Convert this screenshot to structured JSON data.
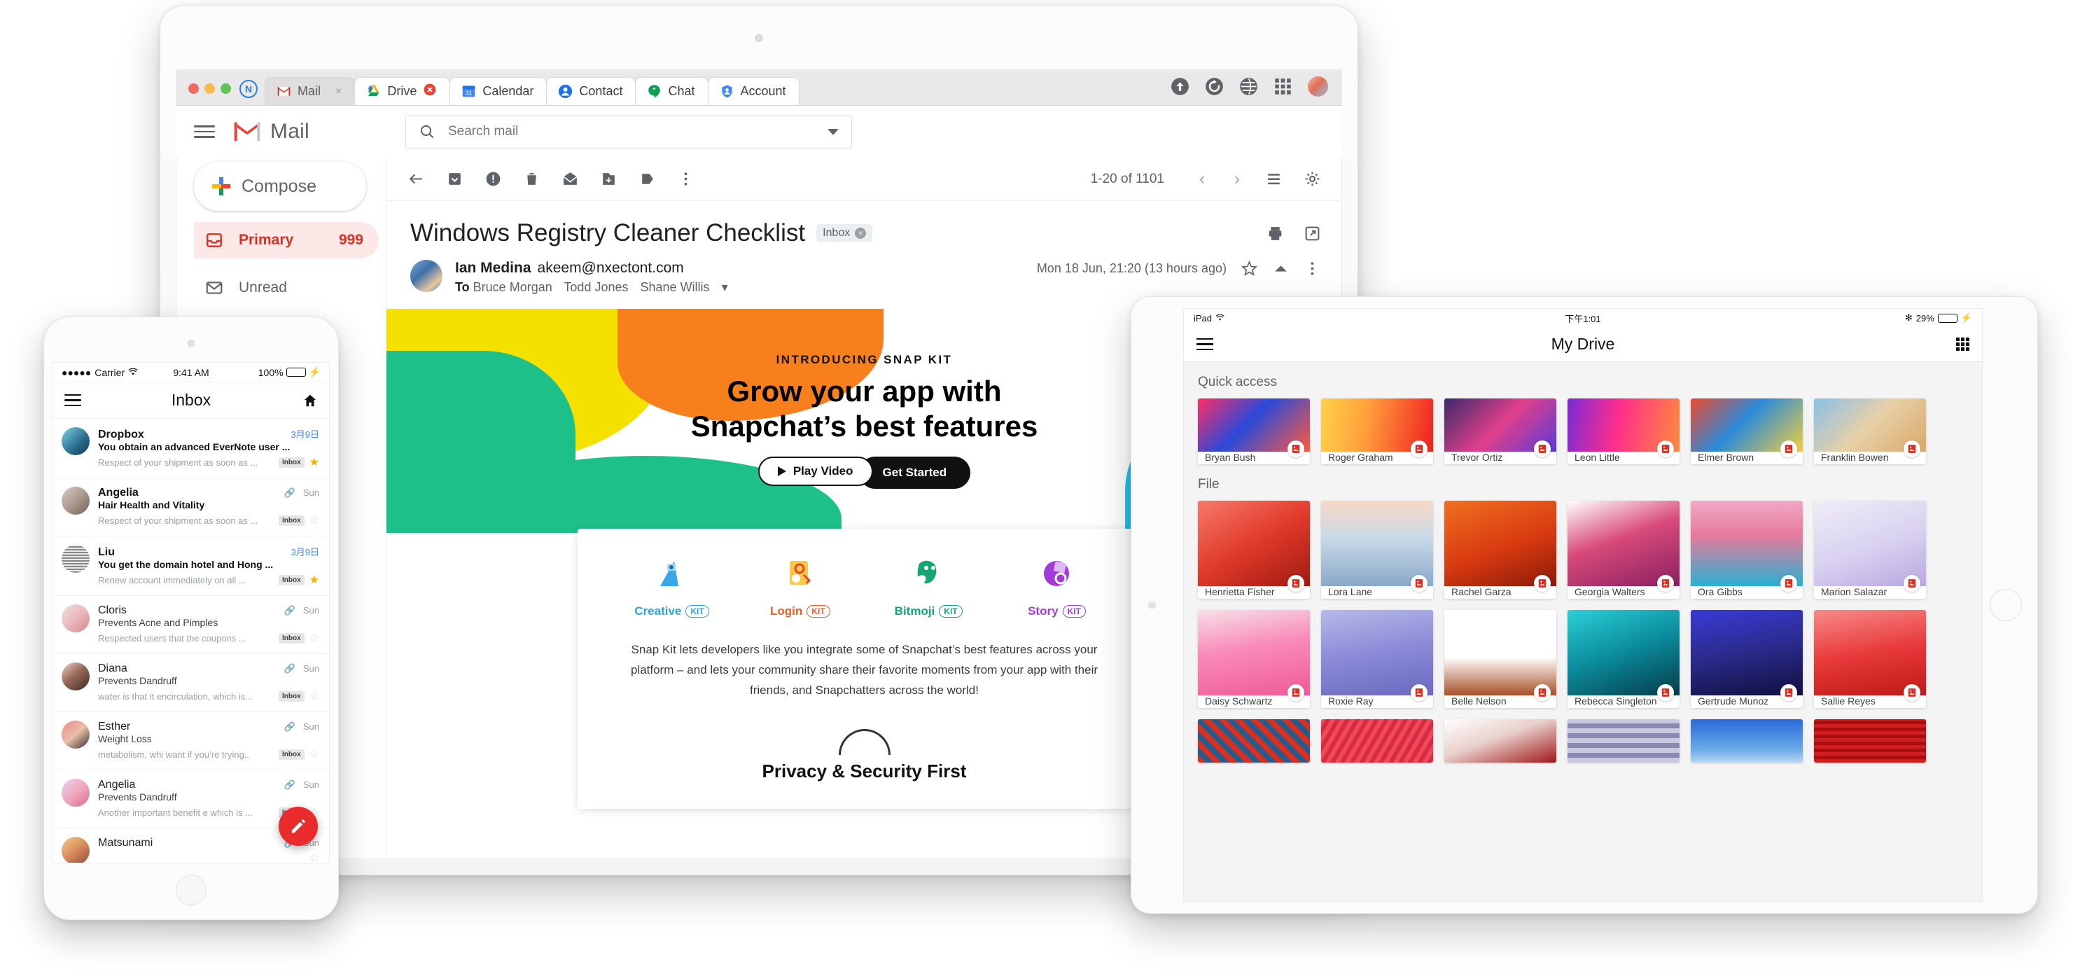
{
  "browser": {
    "logo_text": "N",
    "tabs": [
      {
        "label": "Mail",
        "icon": "gmail-icon",
        "active": true,
        "close": "×"
      },
      {
        "label": "Drive",
        "icon": "drive-icon",
        "active": false,
        "close": "×"
      },
      {
        "label": "Calendar",
        "icon": "calendar-icon",
        "active": false,
        "close": ""
      },
      {
        "label": "Contact",
        "icon": "contact-icon",
        "active": false,
        "close": ""
      },
      {
        "label": "Chat",
        "icon": "chat-icon",
        "active": false,
        "close": ""
      },
      {
        "label": "Account",
        "icon": "account-shield-icon",
        "active": false,
        "close": ""
      }
    ],
    "actions": [
      "upload-icon",
      "refresh-icon",
      "globe-icon",
      "apps-grid-icon",
      "profile-avatar"
    ]
  },
  "gmail": {
    "brand": "Mail",
    "search": {
      "placeholder": "Search  mail",
      "value": ""
    },
    "compose_label": "Compose",
    "nav": [
      {
        "label": "Primary",
        "count": "999",
        "icon": "inbox-icon",
        "selected": true
      },
      {
        "label": "Unread",
        "count": "",
        "icon": "envelope-icon",
        "selected": false
      }
    ],
    "toolbar": {
      "pager": "1-20 of 1101",
      "prev": "‹",
      "next": "›"
    },
    "subject": "Windows Registry Cleaner Checklist",
    "chip": "Inbox",
    "sender": {
      "name": "Ian Medina",
      "email": "akeem@nxectont.com",
      "to_label": "To",
      "recipients": [
        "Bruce Morgan",
        "Todd Jones",
        "Shane Willis"
      ],
      "date": "Mon 18 Jun, 21:20 (13 hours ago)"
    }
  },
  "promo": {
    "kicker": "INTRODUCING SNAP KIT",
    "headline_line1": "Grow your app with",
    "headline_line2": "Snapchat’s best features",
    "play_label": "Play Video",
    "get_label": "Get Started",
    "kits": [
      {
        "name": "Creative",
        "badge": "KIT",
        "color": "#2aa4e0"
      },
      {
        "name": "Login",
        "badge": "KIT",
        "color": "#f05a28"
      },
      {
        "name": "Bitmoji",
        "badge": "KIT",
        "color": "#12a873"
      },
      {
        "name": "Story",
        "badge": "KIT",
        "color": "#a03ed8"
      }
    ],
    "body": "Snap Kit lets developers like you integrate some of Snapchat’s best features across your platform – and lets your community share their favorite moments from your app with their friends, and Snapchatters across the world!",
    "footer_heading": "Privacy & Security First"
  },
  "phone": {
    "status": {
      "carrier": "Carrier",
      "dots": "●●●●●",
      "time": "9:41 AM",
      "battery": "100%"
    },
    "nav_title": "Inbox",
    "messages": [
      {
        "name": "Dropbox",
        "subject": "You obtain an advanced EverNote user ...",
        "preview": "Respect of your shipment as soon as ...",
        "date": "3月9日",
        "date_blue": true,
        "clip": false,
        "badge": "Inbox",
        "starred": true,
        "unread": true,
        "av": "linear-gradient(135deg,#7fd4e8 0%,#2a6b8c 60%,#123a52 100%)"
      },
      {
        "name": "Angelia",
        "subject": "Hair Health and Vitality",
        "preview": "Respect of your shipment as soon as ...",
        "date": "Sun",
        "date_blue": false,
        "clip": true,
        "badge": "Inbox",
        "starred": false,
        "unread": true,
        "av": "linear-gradient(135deg,#d8cec6 0%,#a8958a 55%,#6f5f55 100%)"
      },
      {
        "name": "Liu",
        "subject": "You get the domain hotel and Hong ...",
        "preview": "Renew account immediately on all ...",
        "date": "3月9日",
        "date_blue": true,
        "clip": false,
        "badge": "Inbox",
        "starred": true,
        "unread": true,
        "av": "repeating-linear-gradient(0deg,#888 0 2px,#e8e8e8 2px 4px)"
      },
      {
        "name": "Cloris",
        "subject": "Prevents Acne and Pimples",
        "preview": "Respected users that the coupons  ...",
        "date": "Sun",
        "date_blue": false,
        "clip": true,
        "badge": "Inbox",
        "starred": false,
        "unread": false,
        "av": "linear-gradient(135deg,#f0e2e0 0%,#e8b8bc 50%,#d8868c 100%)"
      },
      {
        "name": "Diana",
        "subject": "Prevents Dandruff",
        "preview": "water is that it encirculation, which is...",
        "date": "Sun",
        "date_blue": false,
        "clip": true,
        "badge": "Inbox",
        "starred": false,
        "unread": false,
        "av": "linear-gradient(140deg,#e8d8d0 0%,#9a6a58 45%,#3a2a26 100%)"
      },
      {
        "name": "Esther",
        "subject": "Weight Loss",
        "preview": "metabolism, whi want if you’re trying..",
        "date": "Sun",
        "date_blue": false,
        "clip": true,
        "badge": "Inbox",
        "starred": false,
        "unread": false,
        "av": "linear-gradient(140deg,#f0868c 0%,#e8c0a8 50%,#3a2a2a 100%)"
      },
      {
        "name": "Angelia",
        "subject": "Prevents Dandruff",
        "preview": "Another important benefit e which is ...",
        "date": "Sun",
        "date_blue": false,
        "clip": true,
        "badge": "Inbox",
        "starred": false,
        "unread": false,
        "av": "linear-gradient(140deg,#e8d0f0 0%,#f0a8c0 50%,#d86a88 100%)"
      },
      {
        "name": "Matsunami",
        "subject": "",
        "preview": "",
        "date": "Sun",
        "date_blue": false,
        "clip": true,
        "badge": "",
        "starred": false,
        "unread": false,
        "av": "linear-gradient(140deg,#f0d090 0%,#d88a5a 50%,#8a4a3a 100%)"
      }
    ],
    "fab": "compose-pencil-icon"
  },
  "ipad": {
    "status": {
      "device": "iPad",
      "time": "下午1:01",
      "battery": "29%"
    },
    "nav_title": "My Drive",
    "sections": [
      {
        "title": "Quick access"
      },
      {
        "title": "File"
      }
    ],
    "quick_access": [
      {
        "label": "Bryan Bush",
        "thumb": "linear-gradient(135deg,#ff2e63 0%,#2a4ad8 45%,#ff5a3c 100%)"
      },
      {
        "label": "Roger Graham",
        "thumb": "linear-gradient(100deg,#ffd24a 0%,#ffa03c 40%,#f02020 100%)"
      },
      {
        "label": "Trevor Ortiz",
        "thumb": "linear-gradient(135deg,#3a2a6a 0%,#e0408a 50%,#5a3ad8 100%)"
      },
      {
        "label": "Leon Little",
        "thumb": "linear-gradient(100deg,#7a2ad8 0%,#ff2e8a 45%,#ff8a3c 100%)"
      },
      {
        "label": "Elmer Brown",
        "thumb": "linear-gradient(135deg,#f04a2a 0%,#2a8ad8 45%,#f0d040 100%)"
      },
      {
        "label": "Franklin Bowen",
        "thumb": "linear-gradient(135deg,#8ac0e8 0%,#e8d0a8 50%,#d8a868 100%)"
      }
    ],
    "files_row1": [
      {
        "label": "Henrietta Fisher",
        "thumb": "linear-gradient(150deg,#f87a6a 0%,#e03a2a 50%,#a01a10 100%)"
      },
      {
        "label": "Lora Lane",
        "thumb": "linear-gradient(180deg,#f8d8c8 0%,#c8d8e8 45%,#8aa8c8 100%)"
      },
      {
        "label": "Rachel Garza",
        "thumb": "linear-gradient(160deg,#f07020 0%,#d83a10 55%,#8a1a08 100%)"
      },
      {
        "label": "Georgia Walters",
        "thumb": "linear-gradient(160deg,#ffffff 0%,#d84a7a 45%,#8a2060 100%)"
      },
      {
        "label": "Ora Gibbs",
        "thumb": "linear-gradient(180deg,#f0a8c8 0%,#e87a9a 40%,#2ab0d0 100%)"
      },
      {
        "label": "Marion Salazar",
        "thumb": "linear-gradient(160deg,#f0eef8 0%,#d8d0f0 55%,#b8a8e0 100%)"
      }
    ],
    "files_row2": [
      {
        "label": "Daisy Schwartz",
        "thumb": "linear-gradient(170deg,#f8e0e8 0%,#f88ab8 45%,#f05a98 100%)"
      },
      {
        "label": "Roxie Ray",
        "thumb": "linear-gradient(170deg,#b8b8e8 0%,#8a8ad8 50%,#6a6ac0 100%)"
      },
      {
        "label": "Belle Nelson",
        "thumb": "linear-gradient(180deg,#ffffff 0%,#ffffff 55%,#a8502a 100%)"
      },
      {
        "label": "Rebecca Singleton",
        "thumb": "linear-gradient(160deg,#2ad0d8 0%,#0a8a9a 50%,#063a4a 100%)"
      },
      {
        "label": "Gertrude Munoz",
        "thumb": "linear-gradient(170deg,#3a3ad8 0%,#2a2a8a 50%,#101040 100%)"
      },
      {
        "label": "Sallie Reyes",
        "thumb": "linear-gradient(170deg,#f88a8a 0%,#e83a3a 50%,#c01818 100%)"
      }
    ],
    "files_row3": [
      {
        "label": "",
        "thumb": "repeating-linear-gradient(45deg,#d83020 0 8px,#2a5a8a 8px 16px)"
      },
      {
        "label": "",
        "thumb": "repeating-linear-gradient(120deg,#f04a5a 0 6px,#d82a40 6px 12px)"
      },
      {
        "label": "",
        "thumb": "linear-gradient(160deg,#ffffff 0%,#e8d0cc 45%,#a01818 100%)"
      },
      {
        "label": "",
        "thumb": "repeating-linear-gradient(0deg,#c8c8e0 0 7px,#8a8ab0 7px 14px)"
      },
      {
        "label": "",
        "thumb": "linear-gradient(180deg,#2a6ad8 0%,#6aaae8 70%,#b8d8f0 100%)"
      },
      {
        "label": "",
        "thumb": "repeating-linear-gradient(0deg,#d02020 0 5px,#a81010 5px 10px)"
      }
    ]
  }
}
